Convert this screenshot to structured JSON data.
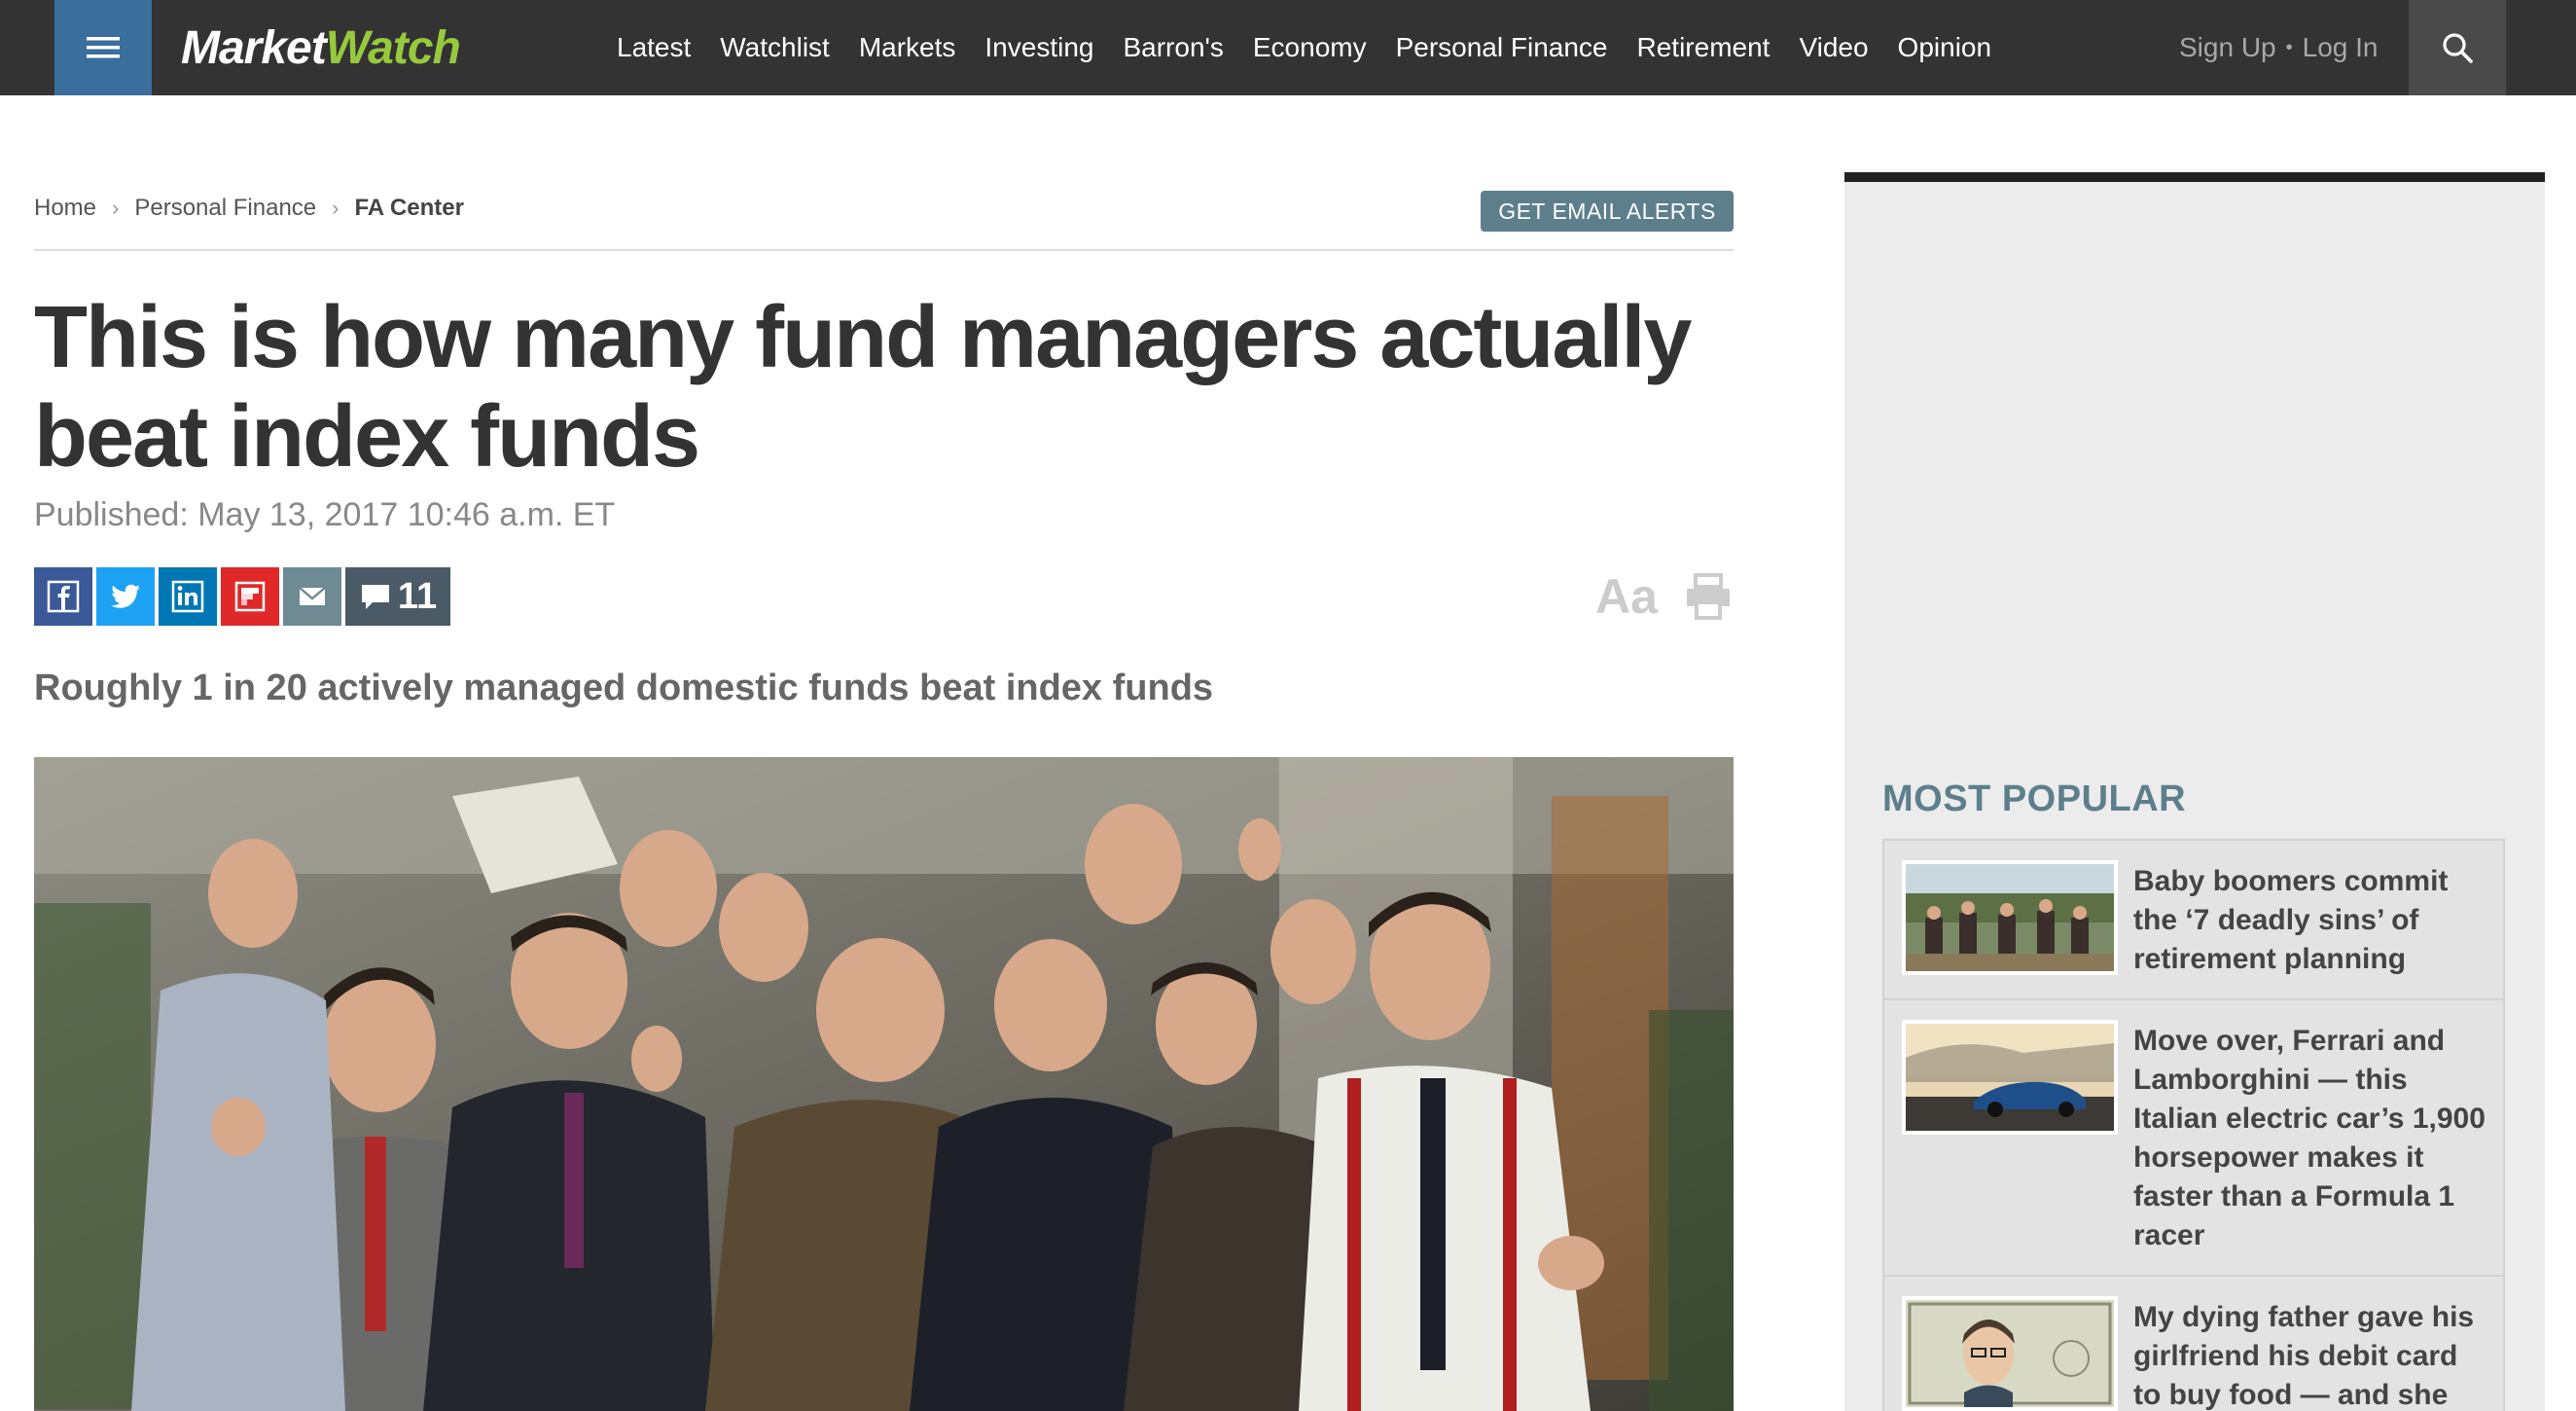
{
  "site": {
    "logo_market": "Market",
    "logo_watch": "Watch"
  },
  "nav": {
    "items": [
      {
        "label": "Latest"
      },
      {
        "label": "Watchlist"
      },
      {
        "label": "Markets"
      },
      {
        "label": "Investing"
      },
      {
        "label": "Barron's"
      },
      {
        "label": "Economy"
      },
      {
        "label": "Personal Finance"
      },
      {
        "label": "Retirement"
      },
      {
        "label": "Video"
      },
      {
        "label": "Opinion"
      }
    ],
    "sign_up": "Sign Up",
    "separator": "•",
    "log_in": "Log In",
    "menu_icon": "hamburger-menu-icon",
    "search_icon": "search-icon"
  },
  "breadcrumb": {
    "items": [
      "Home",
      "Personal Finance",
      "FA Center"
    ],
    "separator": "›"
  },
  "alerts_button": "GET EMAIL ALERTS",
  "article": {
    "headline": "This is how many fund managers actually beat index funds",
    "published": "Published: May 13, 2017 10:46 a.m. ET",
    "subhead": "Roughly 1 in 20 actively managed domestic funds beat index funds",
    "comment_count": "11",
    "font_size_label": "Aa",
    "share_icons": [
      "facebook-icon",
      "twitter-icon",
      "linkedin-icon",
      "flipboard-icon",
      "email-icon",
      "comment-icon"
    ]
  },
  "most_popular": {
    "title": "MOST POPULAR",
    "items": [
      {
        "title": "Baby boomers commit the ‘7 deadly sins’ of retirement planning"
      },
      {
        "title": "Move over, Ferrari and Lamborghini — this Italian electric car’s 1,900 horsepower makes it faster than a Formula 1 racer"
      },
      {
        "title": "My dying father gave his girlfriend his debit card to buy food — and she"
      }
    ]
  },
  "colors": {
    "topbar": "#333333",
    "menu_button": "#3a6e9d",
    "logo_accent": "#97c93d",
    "alerts_button": "#5d7f8c",
    "most_popular_title": "#5d7f8c"
  }
}
